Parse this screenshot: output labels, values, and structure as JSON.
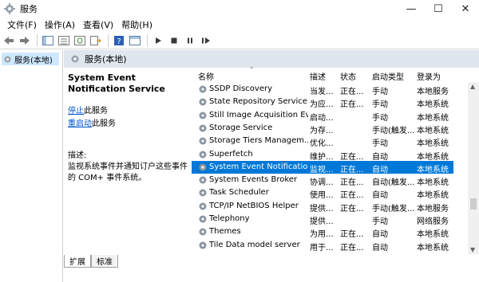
{
  "window": {
    "title": "服务"
  },
  "menu": [
    "文件(F)",
    "操作(A)",
    "查看(V)",
    "帮助(H)"
  ],
  "left_tree": {
    "label": "服务(本地)"
  },
  "header_strip": {
    "label": "服务(本地)"
  },
  "detail": {
    "title": "System Event Notification Service",
    "stop_link": "停止",
    "stop_suffix": "此服务",
    "restart_link": "重启动",
    "restart_suffix": "此服务",
    "desc_label": "描述:",
    "desc_text": "监视系统事件并通知订户这些事件的 COM+ 事件系统。"
  },
  "columns": [
    "名称",
    "描述",
    "状态",
    "启动类型",
    "登录为"
  ],
  "rows": [
    {
      "name": "SSDP Discovery",
      "desc": "当发...",
      "status": "正在...",
      "startup": "手动",
      "logon": "本地服务"
    },
    {
      "name": "State Repository Service",
      "desc": "为应...",
      "status": "正在...",
      "startup": "手动",
      "logon": "本地系统"
    },
    {
      "name": "Still Image Acquisition Ev...",
      "desc": "启动...",
      "status": "",
      "startup": "手动",
      "logon": "本地系统"
    },
    {
      "name": "Storage Service",
      "desc": "为存...",
      "status": "",
      "startup": "手动(触发...",
      "logon": "本地系统"
    },
    {
      "name": "Storage Tiers Managem...",
      "desc": "优化...",
      "status": "",
      "startup": "手动",
      "logon": "本地系统"
    },
    {
      "name": "Superfetch",
      "desc": "维护...",
      "status": "正在...",
      "startup": "自动",
      "logon": "本地系统"
    },
    {
      "name": "System Event Notification...",
      "desc": "监视...",
      "status": "正在...",
      "startup": "自动",
      "logon": "本地系统",
      "selected": true
    },
    {
      "name": "System Events Broker",
      "desc": "协调...",
      "status": "正在...",
      "startup": "自动(触发...",
      "logon": "本地系统"
    },
    {
      "name": "Task Scheduler",
      "desc": "使用...",
      "status": "正在...",
      "startup": "自动",
      "logon": "本地系统"
    },
    {
      "name": "TCP/IP NetBIOS Helper",
      "desc": "提供...",
      "status": "正在...",
      "startup": "手动(触发...",
      "logon": "本地服务"
    },
    {
      "name": "Telephony",
      "desc": "提供...",
      "status": "",
      "startup": "手动",
      "logon": "网络服务"
    },
    {
      "name": "Themes",
      "desc": "为用...",
      "status": "正在...",
      "startup": "自动",
      "logon": "本地系统"
    },
    {
      "name": "Tile Data model server",
      "desc": "用于...",
      "status": "正在...",
      "startup": "自动",
      "logon": "本地系统"
    }
  ],
  "tabs": [
    "扩展",
    "标准"
  ],
  "colors": {
    "accent": "#0078d7",
    "header_strip": "#dfe6ee",
    "link": "#0055cc"
  }
}
